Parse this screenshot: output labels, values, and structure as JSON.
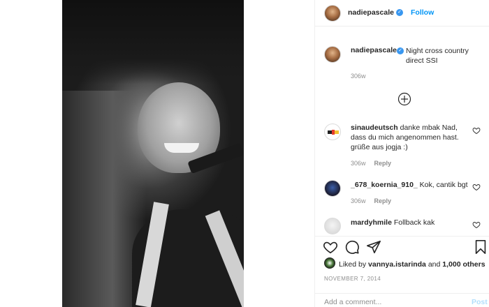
{
  "post": {
    "author": "nadiepascale",
    "follow_label": "Follow",
    "caption": "Night cross country direct SSI",
    "caption_age": "306w"
  },
  "comments": [
    {
      "username": "sinaudeutsch",
      "text": "danke mbak Nad, dass du mich angenommen hast. grüße aus jogja :)",
      "age": "306w",
      "reply_label": "Reply"
    },
    {
      "username": "_678_koernia_910_",
      "text": "Kok, cantik bgt",
      "age": "306w",
      "reply_label": "Reply"
    },
    {
      "username": "mardyhmile",
      "text": "Follback kak"
    }
  ],
  "actions": {
    "liked_by_prefix": "Liked by",
    "liked_by_user": "vannya.istarinda",
    "liked_by_connector": "and",
    "liked_by_others": "1,000 others",
    "date": "NOVEMBER 7, 2014"
  },
  "comment_box": {
    "placeholder": "Add a comment...",
    "post_label": "Post"
  },
  "colors": {
    "accent": "#0095f6",
    "verified": "#3897f0",
    "muted": "#8e8e8e",
    "post_disabled": "#b2dffc"
  },
  "icons": [
    "verified-badge-icon",
    "heart-icon",
    "comment-icon",
    "share-icon",
    "bookmark-icon",
    "add-circle-icon"
  ]
}
